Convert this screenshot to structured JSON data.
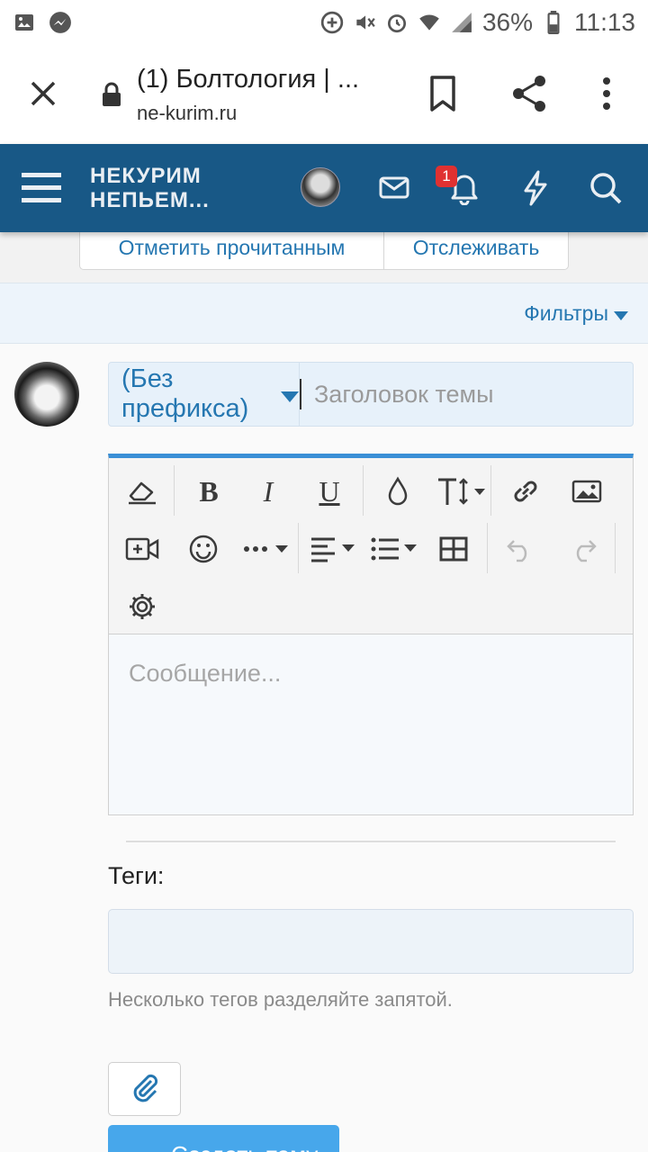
{
  "statusbar": {
    "battery": "36%",
    "time": "11:13"
  },
  "browser": {
    "tab_title": "(1) Болтология | ...",
    "url": "ne-kurim.ru"
  },
  "site_header": {
    "logo_line1": "НЕКУРИМ",
    "logo_line2": "НЕПЬЕМ...",
    "notification_count": "1",
    "brand_color": "#185886"
  },
  "actions": {
    "mark_read": "Отметить прочитанным",
    "watch": "Отслеживать"
  },
  "filters": {
    "label": "Фильтры"
  },
  "form": {
    "prefix": "(Без префикса)",
    "title_placeholder": "Заголовок темы",
    "message_placeholder": "Сообщение...",
    "tags_label": "Теги:",
    "tags_hint": "Несколько тегов разделяйте запятой.",
    "submit_label": "Создать тему"
  },
  "toolbar": {
    "icons": [
      "eraser-icon",
      "bold-icon",
      "italic-icon",
      "underline-icon",
      "color-icon",
      "text-size-icon",
      "link-icon",
      "image-icon",
      "video-icon",
      "smiley-icon",
      "more-icon",
      "align-icon",
      "list-icon",
      "table-icon",
      "undo-icon",
      "redo-icon",
      "settings-icon"
    ],
    "bold": "B",
    "italic": "I",
    "underline": "U"
  },
  "colors": {
    "accent": "#2577b1",
    "button": "#47a7eb",
    "badge": "#e03131"
  }
}
